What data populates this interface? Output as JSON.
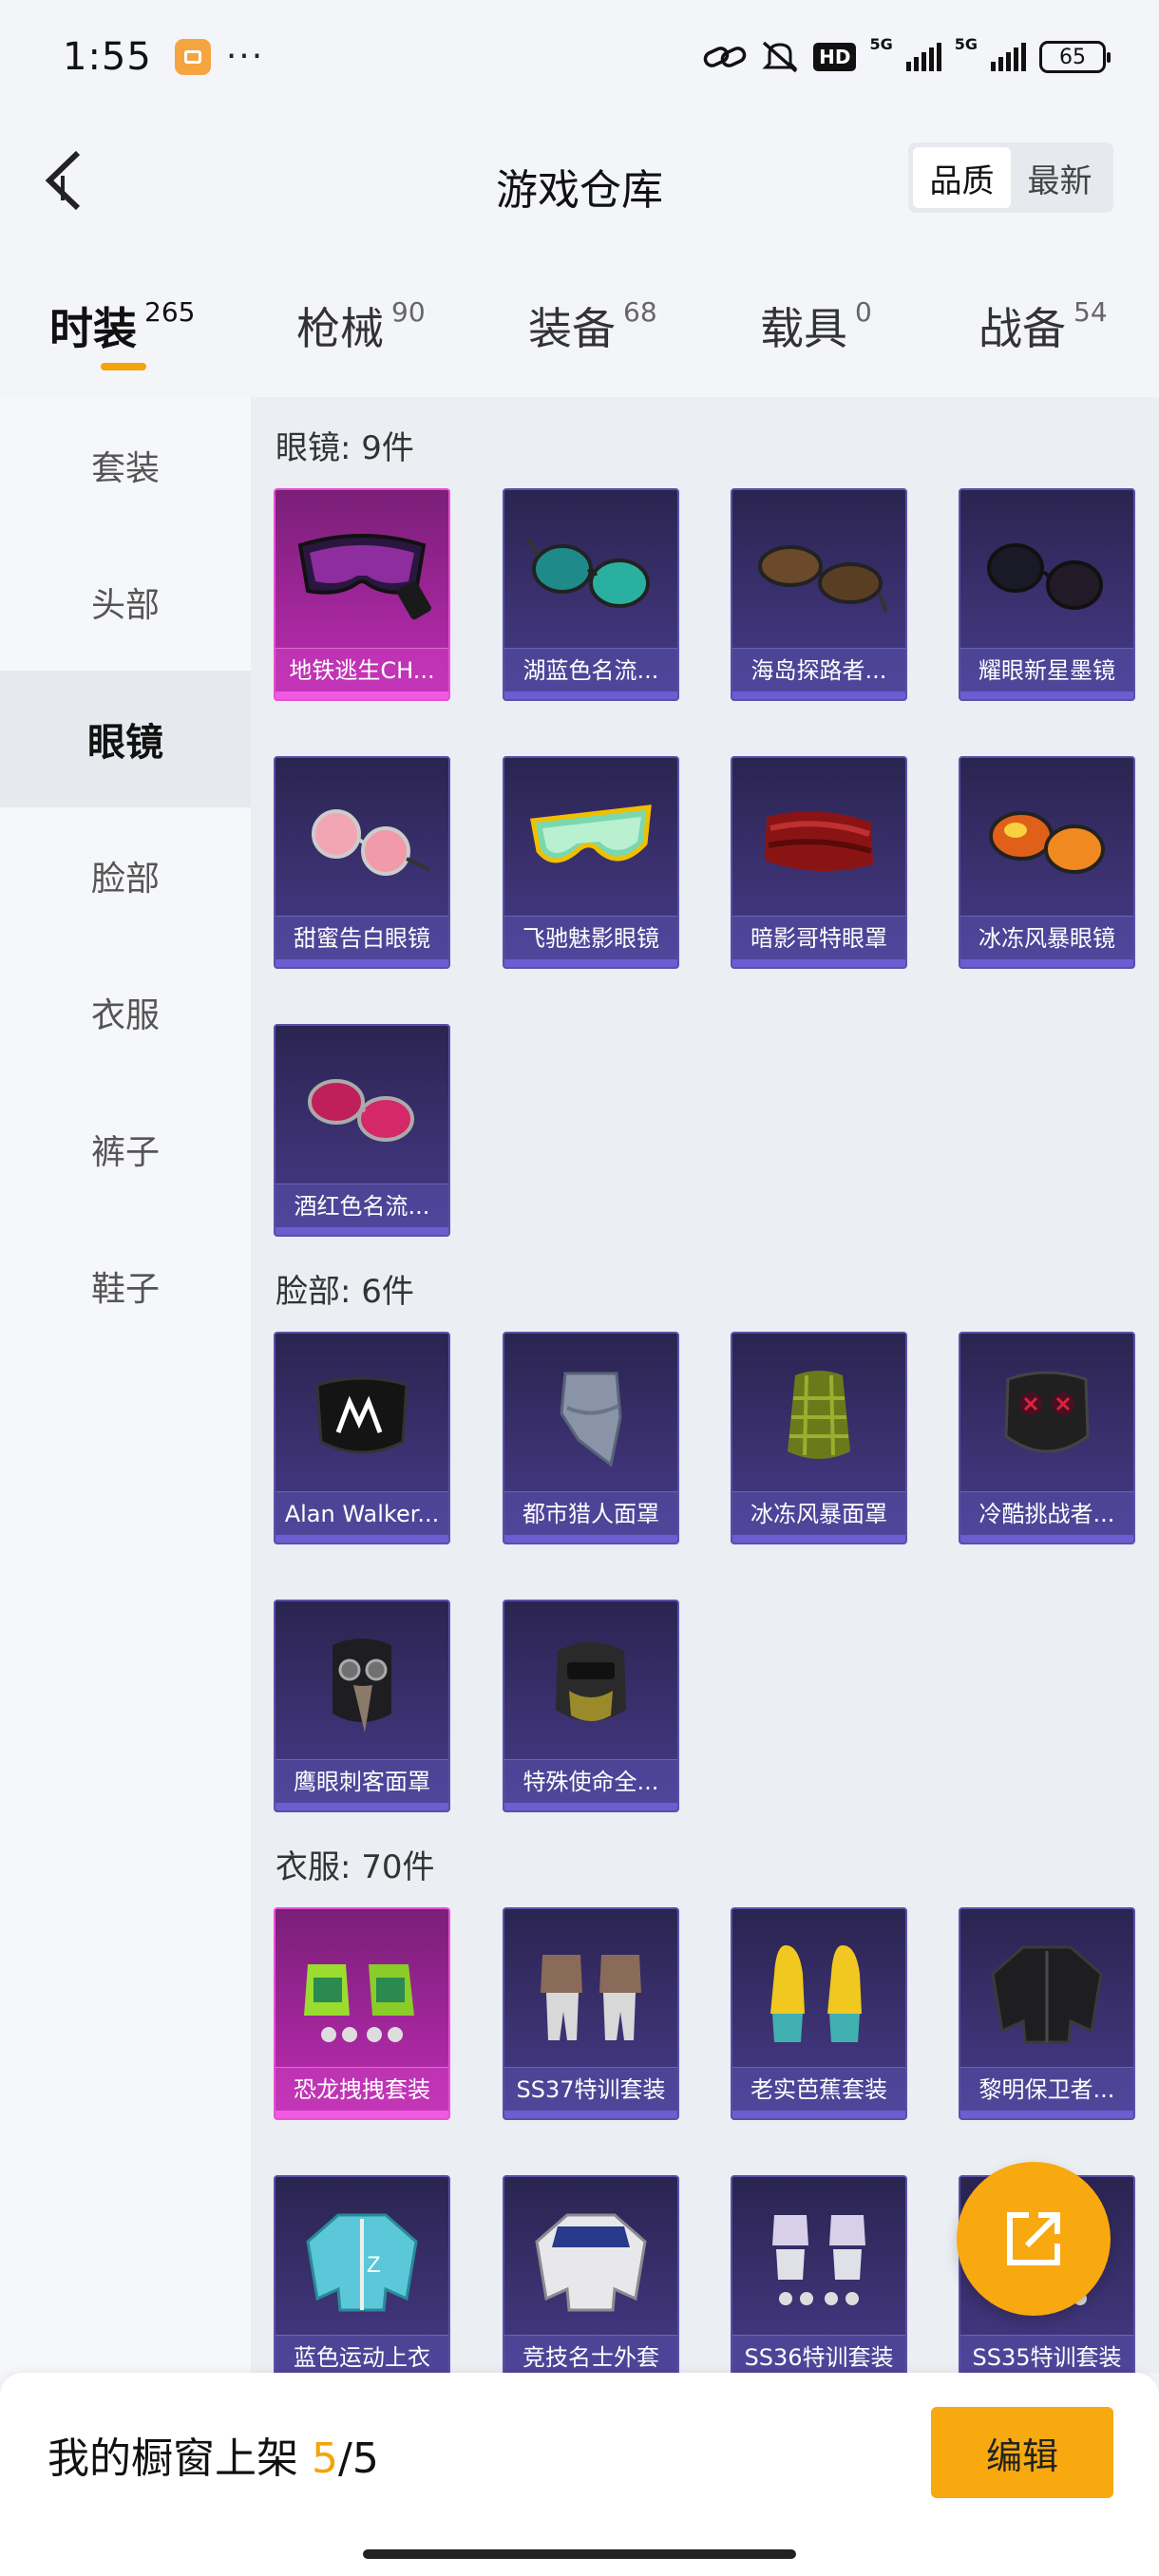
{
  "status_bar": {
    "time": "1:55",
    "network_hd": "HD",
    "network_5g_1": "5G",
    "network_5g_2": "5G",
    "battery": "65"
  },
  "header": {
    "title": "游戏仓库",
    "sort_options": [
      "品质",
      "最新"
    ],
    "sort_selected": "品质"
  },
  "tabs": [
    {
      "label": "时装",
      "count": "265"
    },
    {
      "label": "枪械",
      "count": "90"
    },
    {
      "label": "装备",
      "count": "68"
    },
    {
      "label": "载具",
      "count": "0"
    },
    {
      "label": "战备",
      "count": "54"
    }
  ],
  "active_tab": "时装",
  "sidebar": {
    "items": [
      "套装",
      "头部",
      "眼镜",
      "脸部",
      "衣服",
      "裤子",
      "鞋子"
    ],
    "active": "眼镜"
  },
  "sections": {
    "glasses": {
      "title": "眼镜: 9件",
      "items": [
        {
          "name": "地铁逃生CH...",
          "rarity": "pink"
        },
        {
          "name": "湖蓝色名流...",
          "rarity": "purple"
        },
        {
          "name": "海岛探路者...",
          "rarity": "purple"
        },
        {
          "name": "耀眼新星墨镜",
          "rarity": "purple"
        },
        {
          "name": "甜蜜告白眼镜",
          "rarity": "purple"
        },
        {
          "name": "飞驰魅影眼镜",
          "rarity": "purple"
        },
        {
          "name": "暗影哥特眼罩",
          "rarity": "purple"
        },
        {
          "name": "冰冻风暴眼镜",
          "rarity": "purple"
        },
        {
          "name": "酒红色名流...",
          "rarity": "purple"
        }
      ]
    },
    "face": {
      "title": "脸部: 6件",
      "items": [
        {
          "name": "Alan Walker...",
          "rarity": "purple"
        },
        {
          "name": "都市猎人面罩",
          "rarity": "purple"
        },
        {
          "name": "冰冻风暴面罩",
          "rarity": "purple"
        },
        {
          "name": "冷酷挑战者...",
          "rarity": "purple"
        },
        {
          "name": "鹰眼刺客面罩",
          "rarity": "purple"
        },
        {
          "name": "特殊使命全...",
          "rarity": "purple"
        }
      ]
    },
    "clothes": {
      "title": "衣服: 70件",
      "items": [
        {
          "name": "恐龙拽拽套装",
          "rarity": "pink"
        },
        {
          "name": "SS37特训套装",
          "rarity": "purple"
        },
        {
          "name": "老实芭蕉套装",
          "rarity": "purple"
        },
        {
          "name": "黎明保卫者...",
          "rarity": "purple"
        },
        {
          "name": "蓝色运动上衣",
          "rarity": "purple"
        },
        {
          "name": "竞技名士外套",
          "rarity": "purple"
        },
        {
          "name": "SS36特训套装",
          "rarity": "purple"
        },
        {
          "name": "SS35特训套装",
          "rarity": "purple"
        }
      ]
    }
  },
  "bottom_bar": {
    "showcase_label": "我的橱窗上架",
    "showcase_current": "5",
    "showcase_sep": "/",
    "showcase_total": "5",
    "edit_label": "编辑"
  },
  "colors": {
    "accent": "#f7a90f",
    "card_purple": "#3b3170",
    "card_pink": "#a3269c"
  }
}
